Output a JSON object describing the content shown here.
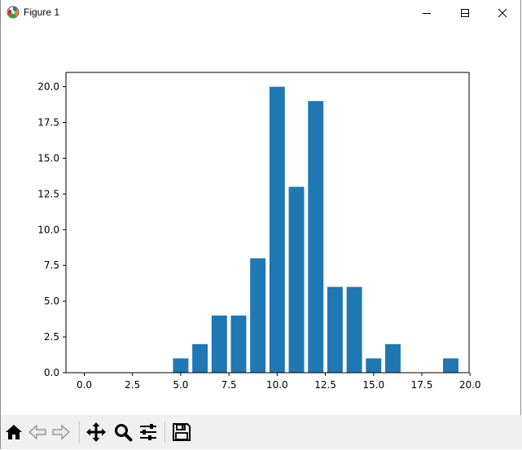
{
  "window": {
    "title": "Figure 1",
    "buttons": [
      "minimize",
      "maximize",
      "close"
    ]
  },
  "toolbar": {
    "buttons": [
      {
        "name": "home-button",
        "icon": "home-icon"
      },
      {
        "name": "back-button",
        "icon": "arrow-left-icon"
      },
      {
        "name": "forward-button",
        "icon": "arrow-right-icon"
      },
      {
        "name": "pan-button",
        "icon": "move-icon"
      },
      {
        "name": "zoom-button",
        "icon": "magnifier-icon"
      },
      {
        "name": "configure-subplots-button",
        "icon": "sliders-icon"
      },
      {
        "name": "save-button",
        "icon": "floppy-disk-icon"
      }
    ]
  },
  "chart_data": {
    "type": "bar",
    "x": [
      5,
      6,
      7,
      8,
      9,
      10,
      11,
      12,
      13,
      14,
      15,
      16,
      19
    ],
    "values": [
      1,
      2,
      4,
      4,
      8,
      20,
      13,
      19,
      6,
      6,
      1,
      2,
      1
    ],
    "bar_width": 0.8,
    "xlim": [
      -0.95,
      19.95
    ],
    "ylim": [
      0,
      21
    ],
    "xticks": [
      0.0,
      2.5,
      5.0,
      7.5,
      10.0,
      12.5,
      15.0,
      17.5,
      20.0
    ],
    "yticks": [
      0.0,
      2.5,
      5.0,
      7.5,
      10.0,
      12.5,
      15.0,
      17.5,
      20.0
    ],
    "xtick_labels": [
      "0.0",
      "2.5",
      "5.0",
      "7.5",
      "10.0",
      "12.5",
      "15.0",
      "17.5",
      "20.0"
    ],
    "ytick_labels": [
      "0.0",
      "2.5",
      "5.0",
      "7.5",
      "10.0",
      "12.5",
      "15.0",
      "17.5",
      "20.0"
    ],
    "bar_color": "#1f77b4",
    "grid": false,
    "title": "",
    "xlabel": "",
    "ylabel": ""
  }
}
